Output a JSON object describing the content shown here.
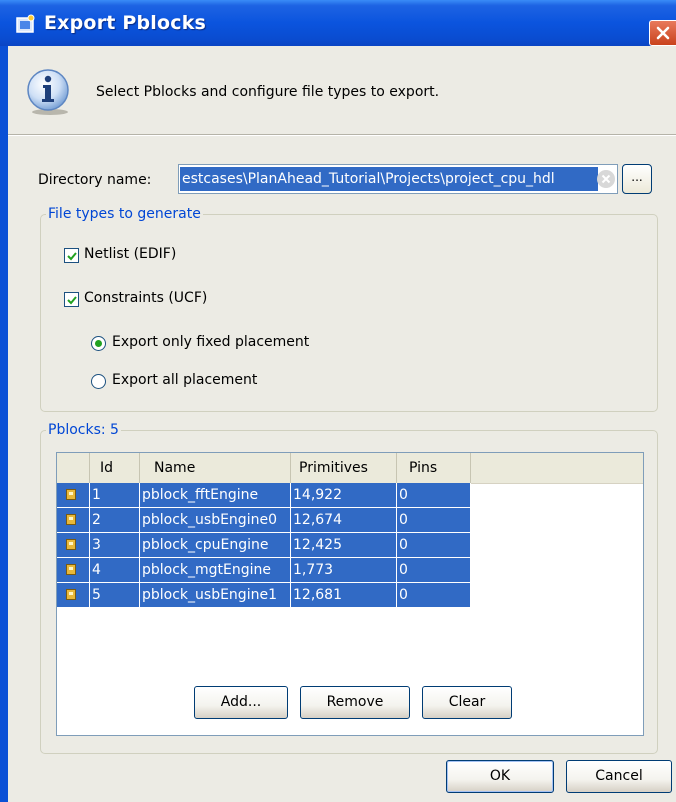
{
  "window": {
    "title": "Export Pblocks"
  },
  "header": {
    "message": "Select Pblocks and configure file types to export."
  },
  "directory": {
    "label": "Directory name:",
    "value": "estcases\\PlanAhead_Tutorial\\Projects\\project_cpu_hdl",
    "browse_label": "..."
  },
  "file_types": {
    "legend": "File types to generate",
    "netlist": {
      "label": "Netlist (EDIF)",
      "checked": true
    },
    "constraints": {
      "label": "Constraints (UCF)",
      "checked": true
    },
    "placement_options": [
      {
        "label": "Export only fixed placement",
        "selected": true
      },
      {
        "label": "Export all placement",
        "selected": false
      }
    ]
  },
  "pblocks": {
    "legend": "Pblocks: 5",
    "columns": [
      "Id",
      "Name",
      "Primitives",
      "Pins"
    ],
    "rows": [
      {
        "id": "1",
        "name": "pblock_fftEngine",
        "primitives": "14,922",
        "pins": "0"
      },
      {
        "id": "2",
        "name": "pblock_usbEngine0",
        "primitives": "12,674",
        "pins": "0"
      },
      {
        "id": "3",
        "name": "pblock_cpuEngine",
        "primitives": "12,425",
        "pins": "0"
      },
      {
        "id": "4",
        "name": "pblock_mgtEngine",
        "primitives": "1,773",
        "pins": "0"
      },
      {
        "id": "5",
        "name": "pblock_usbEngine1",
        "primitives": "12,681",
        "pins": "0"
      }
    ],
    "add_label": "Add...",
    "remove_label": "Remove",
    "clear_label": "Clear"
  },
  "footer": {
    "ok_label": "OK",
    "cancel_label": "Cancel"
  },
  "colors": {
    "titlebar": "#0a54de",
    "selection": "#316ac5",
    "legend_text": "#0046d5",
    "dialog_bg": "#ecebe4"
  }
}
